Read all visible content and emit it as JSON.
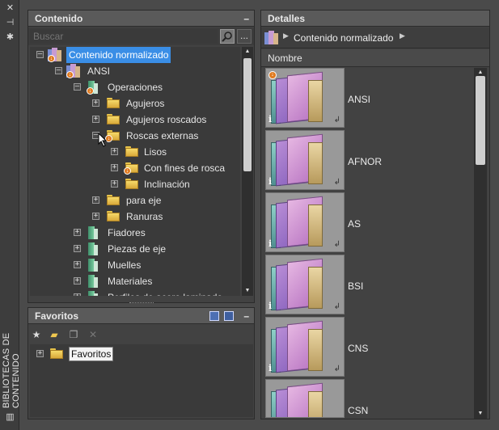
{
  "sidebar": {
    "title": "BIBLIOTECAS DE CONTENIDO",
    "icons": [
      "close-icon",
      "pin-icon",
      "settings-icon",
      "library-icon"
    ]
  },
  "content_panel": {
    "title": "Contenido",
    "collapse_label": "–",
    "search": {
      "placeholder": "Buscar",
      "more_label": "..."
    },
    "tree": [
      {
        "label": "Contenido normalizado",
        "expander": "–",
        "selected": true
      },
      {
        "label": "ANSI",
        "expander": "–"
      },
      {
        "label": "Operaciones",
        "expander": "–"
      },
      {
        "label": "Agujeros",
        "expander": "+"
      },
      {
        "label": "Agujeros roscados",
        "expander": "+"
      },
      {
        "label": "Roscas externas",
        "expander": "–"
      },
      {
        "label": "Lisos",
        "expander": "+"
      },
      {
        "label": "Con fines de rosca",
        "expander": "+"
      },
      {
        "label": "Inclinación",
        "expander": "+"
      },
      {
        "label": "para eje",
        "expander": "+"
      },
      {
        "label": "Ranuras",
        "expander": "+"
      },
      {
        "label": "Fiadores",
        "expander": "+"
      },
      {
        "label": "Piezas de eje",
        "expander": "+"
      },
      {
        "label": "Muelles",
        "expander": "+"
      },
      {
        "label": "Materiales",
        "expander": "+"
      },
      {
        "label": "Perfiles de acero laminado",
        "expander": "+"
      }
    ]
  },
  "favorites_panel": {
    "title": "Favoritos",
    "collapse_label": "–",
    "tree": [
      {
        "label": "Favoritos",
        "expander": "+"
      }
    ]
  },
  "details_panel": {
    "title": "Detalles",
    "breadcrumb": "Contenido normalizado",
    "column_header": "Nombre",
    "items": [
      {
        "name": "ANSI",
        "download": true
      },
      {
        "name": "AFNOR",
        "download": false
      },
      {
        "name": "AS",
        "download": false
      },
      {
        "name": "BSI",
        "download": false
      },
      {
        "name": "CNS",
        "download": false
      },
      {
        "name": "CSN",
        "download": false
      }
    ]
  },
  "colors": {
    "selection": "#3a8ee6",
    "folder": "#f0c850",
    "badge": "#e07a1f"
  }
}
